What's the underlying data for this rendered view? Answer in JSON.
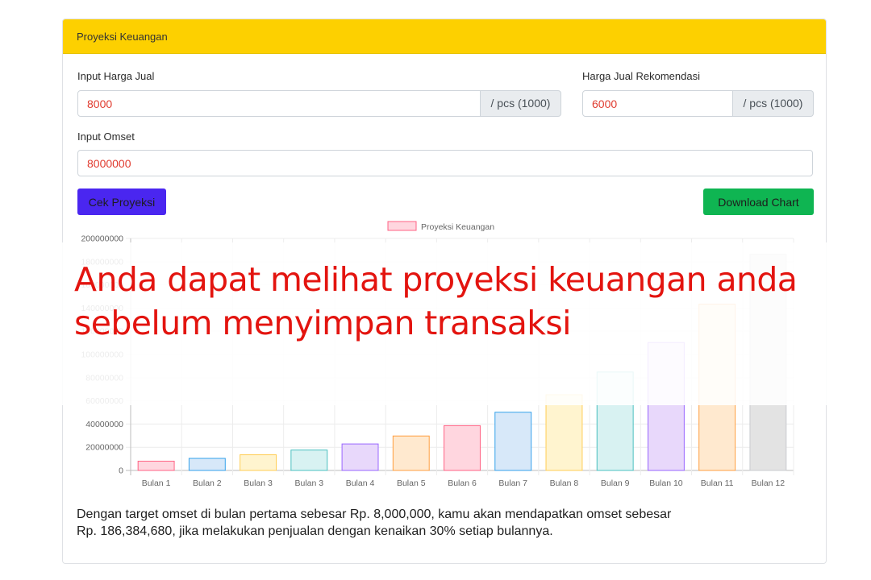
{
  "card": {
    "header_title": "Proyeksi Keuangan"
  },
  "form": {
    "harga_jual_label": "Input Harga Jual",
    "harga_jual_value": "8000",
    "harga_jual_addon": "/ pcs (1000)",
    "harga_rekomendasi_label": "Harga Jual Rekomendasi",
    "harga_rekomendasi_value": "6000",
    "harga_rekomendasi_addon": "/ pcs (1000)",
    "omset_label": "Input Omset",
    "omset_value": "8000000"
  },
  "buttons": {
    "cek_label": "Cek Proyeksi",
    "download_label": "Download Chart"
  },
  "colors": {
    "header_bg": "#fdd000",
    "cek_bg": "#4a26f0",
    "download_bg": "#0fb552",
    "input_text": "#e03b2f",
    "overlay_text": "#e3140f"
  },
  "chart_data": {
    "type": "bar",
    "legend": [
      "Proyeksi Keuangan"
    ],
    "legend_position": "top-center",
    "categories": [
      "Bulan 1",
      "Bulan 2",
      "Bulan 3",
      "Bulan 3",
      "Bulan 4",
      "Bulan 5",
      "Bulan 6",
      "Bulan 7",
      "Bulan 8",
      "Bulan 9",
      "Bulan 10",
      "Bulan 11",
      "Bulan 12"
    ],
    "series": [
      {
        "name": "Proyeksi Keuangan",
        "values": [
          8000000,
          10400000,
          13520000,
          17576000,
          22848800,
          29703440,
          38614472,
          50198814,
          65258458,
          84835996,
          110286795,
          143372833,
          186384680
        ]
      }
    ],
    "bar_fill": [
      "#ffd6df",
      "#d7e8f9",
      "#fff4cf",
      "#d8f2f2",
      "#e8d8fb",
      "#ffe9cf",
      "#ffd6df",
      "#d7e8f9",
      "#fff4cf",
      "#d8f2f2",
      "#e8d8fb",
      "#ffe9cf",
      "#e3e3e3"
    ],
    "bar_stroke": [
      "#ff6384",
      "#36a2eb",
      "#ffce56",
      "#4bc0c0",
      "#9966ff",
      "#ff9f40",
      "#ff6384",
      "#36a2eb",
      "#ffce56",
      "#4bc0c0",
      "#9966ff",
      "#ff9f40",
      "#c9cbcf"
    ],
    "ylim": [
      0,
      200000000
    ],
    "y_ticks": [
      "0",
      "20000000",
      "40000000",
      "60000000",
      "80000000",
      "100000000",
      "120000000",
      "140000000",
      "160000000",
      "180000000",
      "200000000"
    ],
    "grid": true
  },
  "overlay": {
    "line1": "Anda dapat melihat proyeksi keuangan anda",
    "line2": "sebelum menyimpan transaksi"
  },
  "summary": {
    "line1": "Dengan target omset di bulan pertama sebesar Rp. 8,000,000, kamu akan mendapatkan omset sebesar",
    "line2": "Rp. 186,384,680, jika melakukan penjualan dengan kenaikan 30% setiap bulannya."
  }
}
